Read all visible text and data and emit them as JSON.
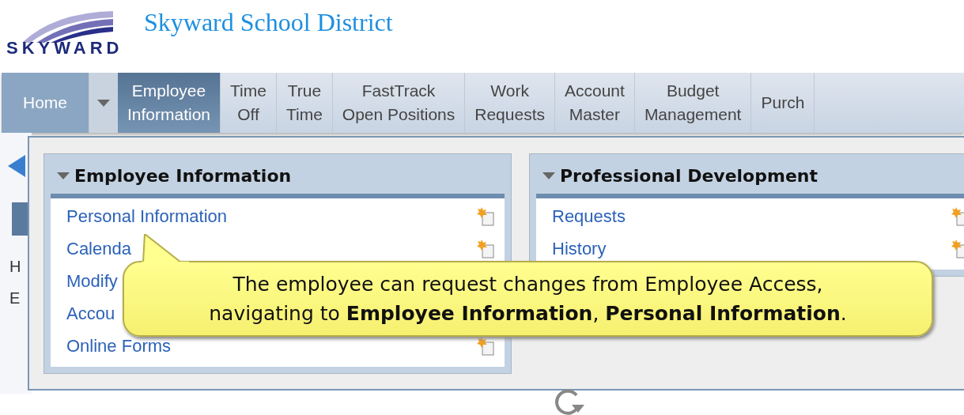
{
  "header": {
    "logo_text": "SKYWARD",
    "title": "Skyward School District"
  },
  "tabs": [
    {
      "label": "Home",
      "kind": "home",
      "selected": false
    },
    {
      "kind": "caret",
      "selected": false
    },
    {
      "label": "Employee\nInformation",
      "kind": "tab",
      "selected": true
    },
    {
      "label": "Time\nOff",
      "kind": "tab",
      "selected": false
    },
    {
      "label": "True\nTime",
      "kind": "tab",
      "selected": false
    },
    {
      "label": "FastTrack\nOpen Positions",
      "kind": "tab",
      "selected": false
    },
    {
      "label": "Work\nRequests",
      "kind": "tab",
      "selected": false
    },
    {
      "label": "Account\nMaster",
      "kind": "tab",
      "selected": false
    },
    {
      "label": "Budget\nManagement",
      "kind": "tab",
      "selected": false
    },
    {
      "label": "Purch",
      "kind": "tab",
      "selected": false
    }
  ],
  "background_panel": {
    "letters": [
      "H",
      "E"
    ]
  },
  "cards": [
    {
      "title": "Employee Information",
      "items": [
        {
          "label": "Personal Information",
          "icon": true
        },
        {
          "label": "Calenda",
          "icon": true
        },
        {
          "label": "Modify",
          "icon": false
        },
        {
          "label": "Accou",
          "icon": false
        },
        {
          "label": "Online Forms",
          "icon": true
        }
      ]
    },
    {
      "title": "Professional Development",
      "items": [
        {
          "label": "Requests",
          "icon": true
        },
        {
          "label": "History",
          "icon": true
        }
      ]
    }
  ],
  "callout": {
    "text": "The employee can request changes from Employee Access,\nnavigating to **Employee Information**, **Personal Information**."
  }
}
